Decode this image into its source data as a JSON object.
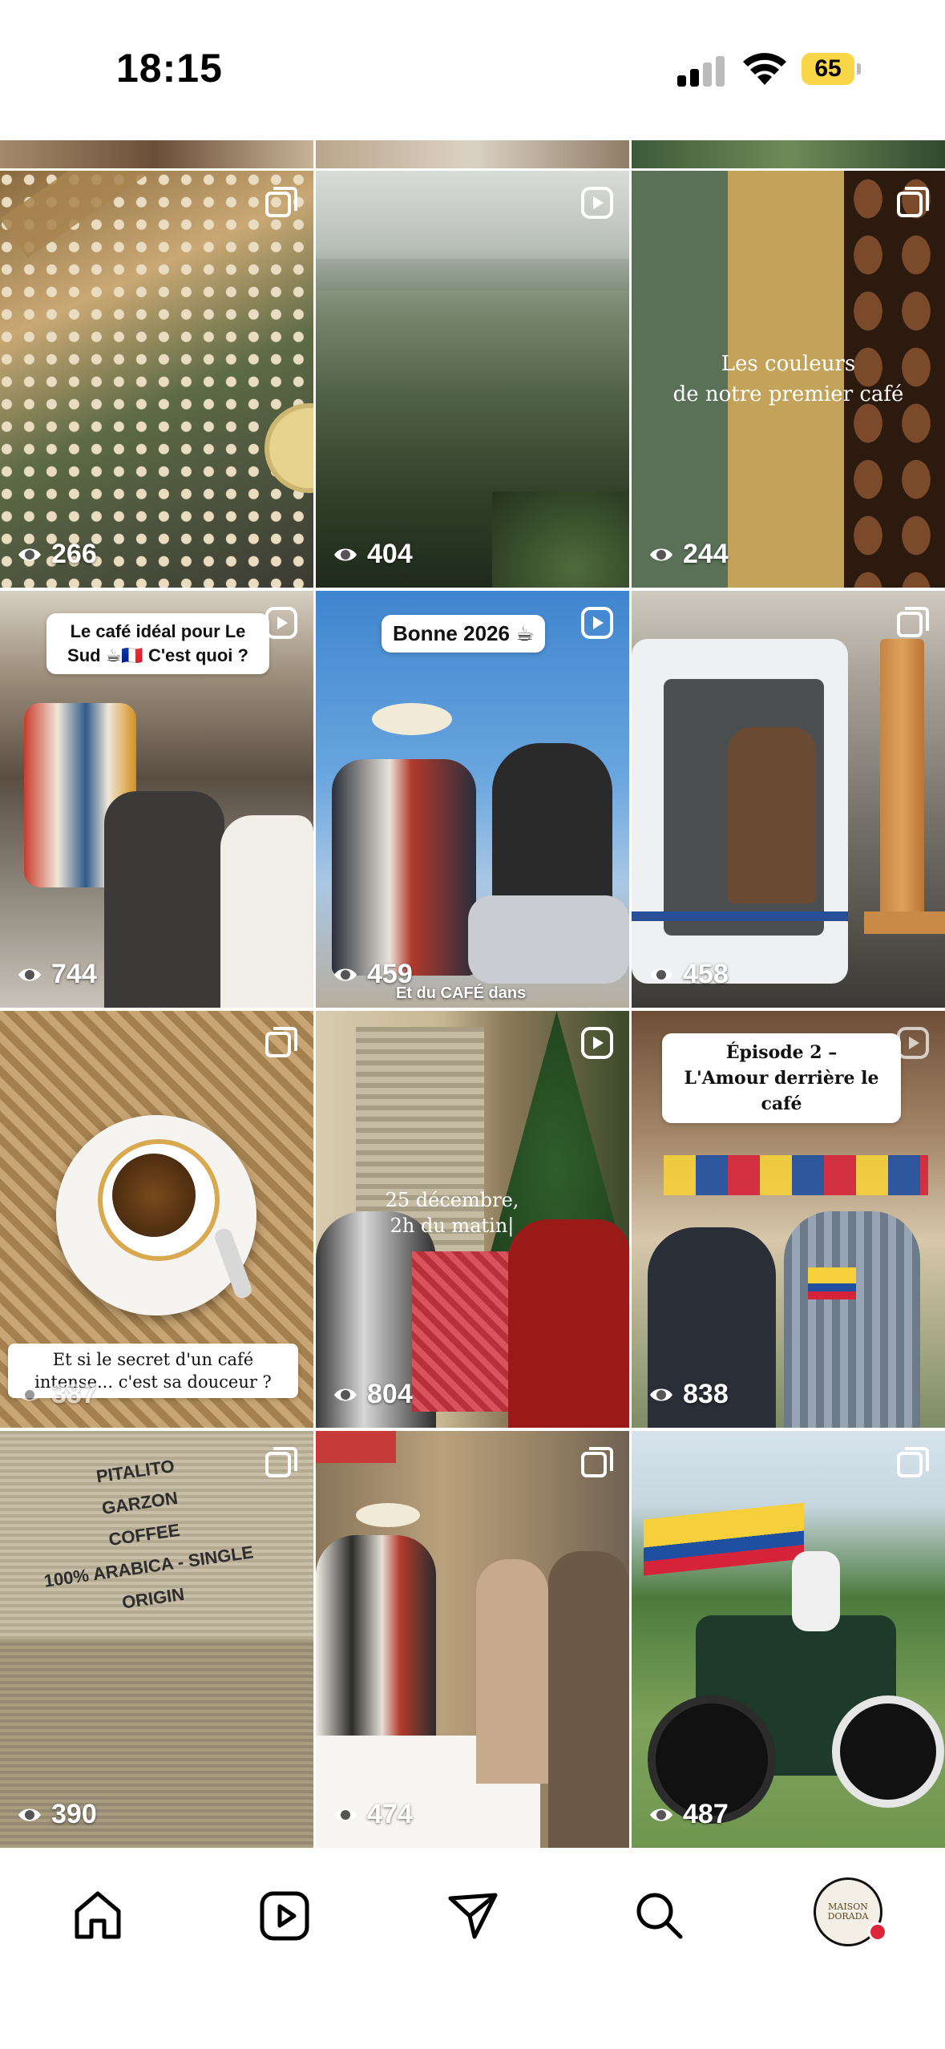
{
  "status": {
    "time": "18:15",
    "battery": "65",
    "icons": [
      "cellular-signal-icon",
      "wifi-icon",
      "battery-icon"
    ]
  },
  "grid": {
    "tiles": [
      {
        "views": "266",
        "type": "carousel"
      },
      {
        "views": "404",
        "type": "reel"
      },
      {
        "views": "244",
        "type": "carousel",
        "overlay": "Les couleurs\nde notre premier café"
      },
      {
        "views": "744",
        "type": "reel",
        "caption": "Le café idéal pour Le Sud ☕🇫🇷 C'est quoi ?"
      },
      {
        "views": "459",
        "type": "reel",
        "caption": "Bonne 2026 ☕",
        "subtitle": "Et du CAFÉ dans"
      },
      {
        "views": "458",
        "type": "carousel"
      },
      {
        "views": "387",
        "type": "carousel",
        "caption": "Et si le secret d'un café intense... c'est sa douceur ?"
      },
      {
        "views": "804",
        "type": "reel",
        "overlay": "25 décembre,\n2h du matin|"
      },
      {
        "views": "838",
        "type": "reel",
        "caption": "Épisode 2 –\nL'Amour derrière le café"
      },
      {
        "views": "390",
        "type": "carousel",
        "sack_text": "PITALITO\nGARZON\nCOFFEE\n100% ARABICA - SINGLE ORIGIN"
      },
      {
        "views": "474",
        "type": "carousel"
      },
      {
        "views": "487",
        "type": "carousel"
      }
    ]
  },
  "tabbar": {
    "items": [
      "home-icon",
      "reels-icon",
      "direct-message-icon",
      "search-icon",
      "profile-avatar"
    ],
    "avatar_text": "MAISON DORADA"
  }
}
